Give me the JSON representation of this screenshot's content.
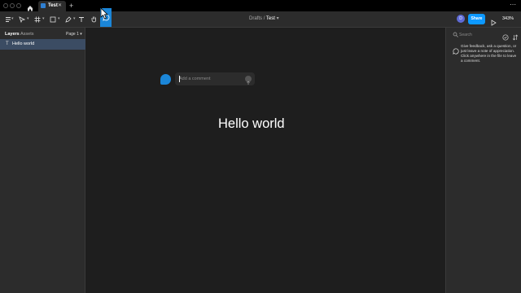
{
  "tab_bar": {
    "tab_title": "Test",
    "new_tab_label": "+",
    "more_label": "⋯"
  },
  "toolbar": {
    "breadcrumb_folder": "Drafts",
    "breadcrumb_sep": "/",
    "breadcrumb_file": "Test",
    "avatar_initial": "D",
    "share_label": "Share",
    "zoom_level": "343%",
    "tools": [
      "main-menu",
      "move-tool",
      "frame-tool",
      "shape-tool",
      "pen-tool",
      "text-tool",
      "hand-tool",
      "comment-tool"
    ],
    "active_tool": "comment-tool",
    "accent_color": "#1b86d8"
  },
  "left_panel": {
    "tabs": [
      "Layers",
      "Assets"
    ],
    "active_tab": "Layers",
    "page_selector": "Page 1",
    "layers": [
      {
        "type_icon": "T",
        "label": "Hello world",
        "selected": true
      }
    ]
  },
  "canvas": {
    "text": "Hello world",
    "comment_placeholder": "Add a comment"
  },
  "right_panel": {
    "search_placeholder": "Search",
    "hint": "Give feedback, ask a question, or just leave a note of appreciation. Click anywhere in the file to leave a comment."
  }
}
